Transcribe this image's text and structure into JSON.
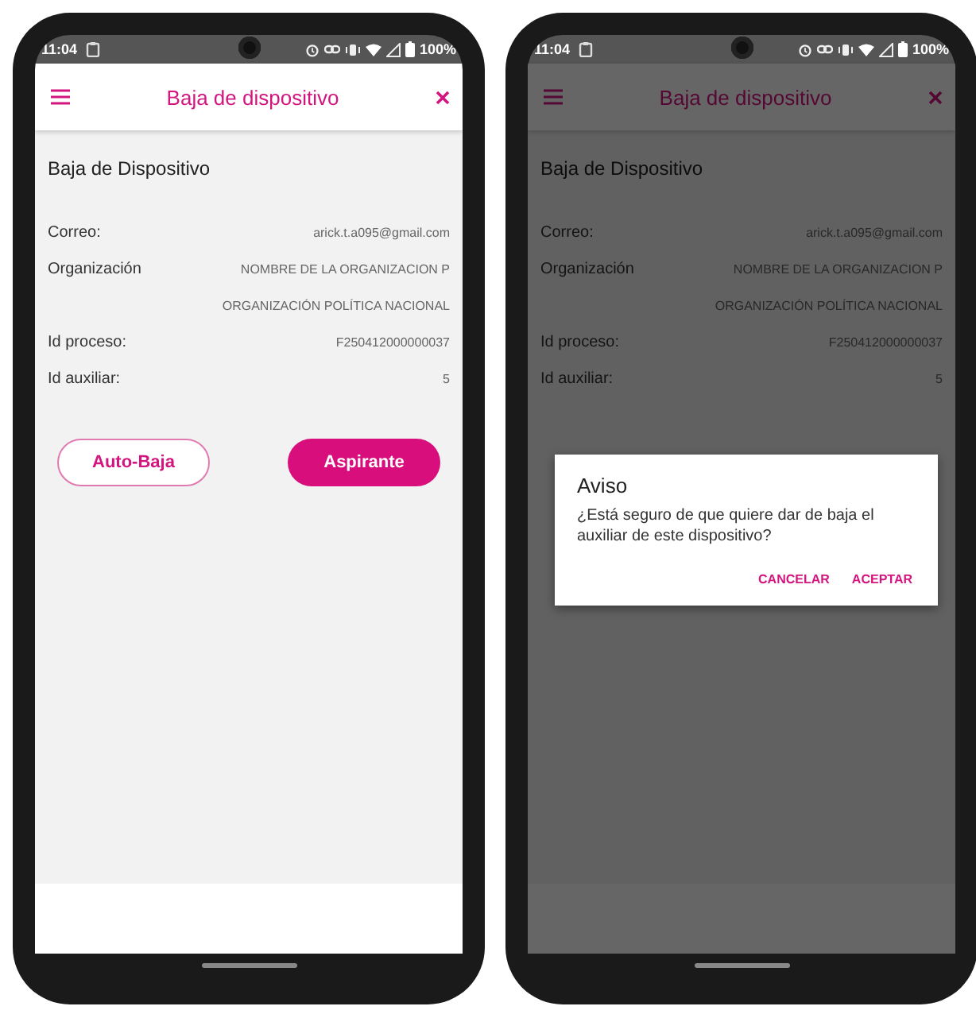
{
  "screens": [
    {
      "status_bar": {
        "time": "11:04",
        "battery": "100%"
      },
      "app_bar": {
        "title": "Baja de dispositivo"
      },
      "heading": "Baja de Dispositivo",
      "rows": [
        {
          "label": "Correo:",
          "value": "arick.t.a095@gmail.com"
        },
        {
          "label": "Organización",
          "value": "NOMBRE DE LA ORGANIZACION P"
        },
        {
          "value": "ORGANIZACIÓN POLÍTICA NACIONAL"
        },
        {
          "label": "Id proceso:",
          "value": "F250412000000037"
        },
        {
          "label": "Id auxiliar:",
          "value": "5"
        }
      ],
      "buttons": [
        {
          "label": "Auto-Baja",
          "kind": "outline"
        },
        {
          "label": "Aspirante",
          "kind": "filled"
        }
      ]
    },
    {
      "status_bar": {
        "time": "11:04",
        "battery": "100%"
      },
      "app_bar": {
        "title": "Baja de dispositivo"
      },
      "heading": "Baja de Dispositivo",
      "rows": [
        {
          "label": "Correo:",
          "value": "arick.t.a095@gmail.com"
        },
        {
          "label": "Organización",
          "value": "NOMBRE DE LA ORGANIZACION P"
        },
        {
          "value": "ORGANIZACIÓN POLÍTICA NACIONAL"
        },
        {
          "label": "Id proceso:",
          "value": "F250412000000037"
        },
        {
          "label": "Id auxiliar:",
          "value": "5"
        }
      ],
      "dialog": {
        "title": "Aviso",
        "message": "¿Está seguro de que quiere dar de baja el auxiliar de este dispositivo?",
        "actions": [
          "CANCELAR",
          "ACEPTAR"
        ]
      }
    }
  ]
}
